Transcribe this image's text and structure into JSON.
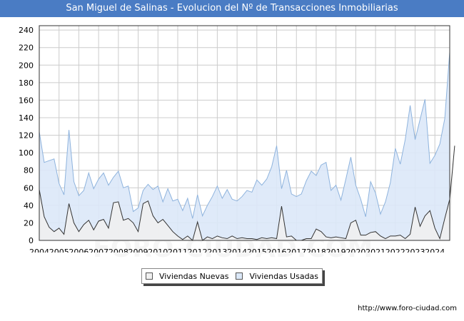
{
  "chart_data": {
    "type": "area",
    "title": "San Miguel de Salinas - Evolucion del Nº de Transacciones Inmobiliarias",
    "xlabel": "",
    "ylabel": "",
    "x_ticks": [
      "2004",
      "2005",
      "2006",
      "2007",
      "2008",
      "2009",
      "2010",
      "2011",
      "2012",
      "2013",
      "2014",
      "2015",
      "2016",
      "2017",
      "2018",
      "2019",
      "2020",
      "2021",
      "2022",
      "2023",
      "2024"
    ],
    "y_ticks": [
      0,
      20,
      40,
      60,
      80,
      100,
      120,
      140,
      160,
      180,
      200,
      220,
      240
    ],
    "ylim": [
      0,
      245
    ],
    "grid": true,
    "legend_position": "bottom",
    "series": [
      {
        "name": "Viviendas Nuevas",
        "color": "#f0f0f0",
        "line_color": "#333333",
        "values": [
          58,
          27,
          15,
          10,
          14,
          7,
          42,
          20,
          10,
          18,
          23,
          12,
          22,
          24,
          14,
          43,
          44,
          23,
          25,
          20,
          10,
          42,
          45,
          28,
          20,
          24,
          17,
          10,
          5,
          1,
          5,
          0,
          21,
          0,
          4,
          2,
          5,
          3,
          2,
          5,
          2,
          3,
          2,
          2,
          1,
          3,
          2,
          3,
          2,
          39,
          4,
          5,
          0,
          0,
          2,
          2,
          13,
          10,
          4,
          3,
          4,
          3,
          2,
          20,
          23,
          6,
          6,
          9,
          10,
          5,
          2,
          5,
          5,
          6,
          2,
          7,
          38,
          16,
          28,
          34,
          14,
          2,
          25,
          47,
          108
        ]
      },
      {
        "name": "Viviendas Usadas",
        "color": "#dbe8f8",
        "line_color": "#8eb3dd",
        "values": [
          124,
          89,
          91,
          93,
          65,
          52,
          126,
          67,
          51,
          57,
          77,
          59,
          70,
          77,
          63,
          72,
          79,
          60,
          62,
          33,
          37,
          57,
          64,
          58,
          62,
          44,
          59,
          45,
          47,
          34,
          48,
          25,
          52,
          28,
          40,
          50,
          62,
          48,
          58,
          47,
          45,
          50,
          57,
          55,
          69,
          63,
          70,
          84,
          108,
          59,
          80,
          53,
          50,
          53,
          68,
          79,
          74,
          86,
          89,
          57,
          63,
          46,
          70,
          95,
          63,
          47,
          27,
          67,
          54,
          30,
          44,
          66,
          105,
          87,
          115,
          154,
          115,
          138,
          161,
          88,
          97,
          110,
          139,
          215
        ]
      }
    ]
  },
  "legend": {
    "nuevas_label": "Viviendas Nuevas",
    "usadas_label": "Viviendas Usadas"
  },
  "footer": {
    "url": "http://www.foro-ciudad.com"
  },
  "watermark": {
    "text": "FORO-CIUDAD.COM"
  },
  "colors": {
    "title_bg": "#4a7cc4",
    "plot_bg": "#ffffff",
    "grid": "#cccccc"
  }
}
